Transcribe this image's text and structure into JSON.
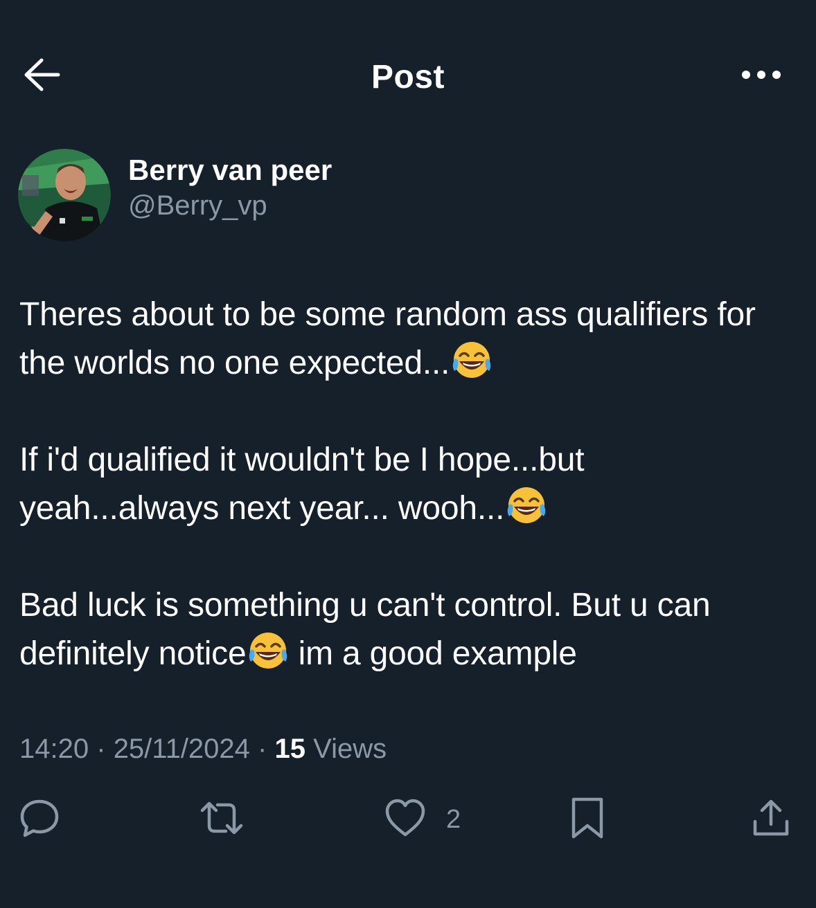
{
  "header": {
    "title": "Post",
    "back_icon": "arrow-left-icon",
    "more_icon": "more-horizontal-icon"
  },
  "author": {
    "display_name": "Berry van peer",
    "handle": "@Berry_vp",
    "avatar": "profile-photo"
  },
  "post": {
    "paragraphs": [
      {
        "text": "Theres about to be some random ass qualifiers for the worlds no one expected...",
        "emoji": "face-with-tears-of-joy",
        "tail": ""
      },
      {
        "text": "If i'd qualified it wouldn't be I hope...but yeah...always next year... wooh...",
        "emoji": "face-with-tears-of-joy",
        "tail": ""
      },
      {
        "text": "Bad luck is something u can't control. But u can definitely notice",
        "emoji": "face-with-tears-of-joy",
        "tail": " im a good example"
      }
    ]
  },
  "meta": {
    "time": "14:20",
    "separator": "·",
    "date": "25/11/2024",
    "views_count": "15",
    "views_label": "Views"
  },
  "actions": {
    "reply_icon": "reply-icon",
    "repost_icon": "repost-icon",
    "like_icon": "heart-icon",
    "like_count": "2",
    "bookmark_icon": "bookmark-icon",
    "share_icon": "share-icon"
  },
  "colors": {
    "background": "#15202b",
    "text_primary": "#ffffff",
    "text_secondary": "#8b98a5"
  }
}
